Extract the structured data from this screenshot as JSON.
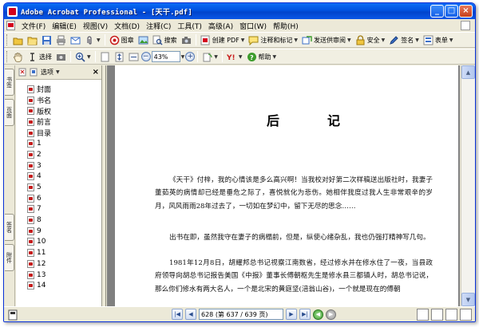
{
  "window": {
    "title": "Adobe Acrobat Professional - [天干.pdf]",
    "controls": {
      "minimize": "_",
      "maximize": "□",
      "close": "×"
    }
  },
  "menu": {
    "items": [
      "文件(F)",
      "编辑(E)",
      "视图(V)",
      "文档(D)",
      "注释(C)",
      "工具(T)",
      "高级(A)",
      "窗口(W)",
      "帮助(H)"
    ]
  },
  "toolbar1": {
    "buttons": [
      {
        "name": "open-icon",
        "color": "#e8b930"
      },
      {
        "name": "folder-icon",
        "color": "#e8b930"
      },
      {
        "name": "save-icon",
        "color": "#3a6fc8"
      },
      {
        "name": "print-icon",
        "color": "#7a7a7a"
      },
      {
        "name": "mail-icon",
        "color": "#3a6fc8"
      },
      {
        "name": "attach-icon",
        "color": "#6a8ab5"
      }
    ],
    "image_label": "图章",
    "search_label": "搜索",
    "create_pdf_label": "创建 PDF",
    "review_label": "注释和标记",
    "send_review_label": "发送供审阅",
    "secure_label": "安全",
    "sign_label": "签名",
    "forms_label": "表单"
  },
  "toolbar2": {
    "select_label": "选择",
    "zoom_value": "43%",
    "help_label": "帮助"
  },
  "left_tabs": [
    "书签",
    "页面",
    "签名",
    "附件"
  ],
  "bookmarks_panel": {
    "options_label": "选项",
    "close": "×",
    "items": [
      "封面",
      "书名",
      "版权",
      "前言",
      "目录",
      "1",
      "2",
      "3",
      "4",
      "5",
      "6",
      "7",
      "8",
      "9",
      "10",
      "11",
      "12",
      "13",
      "14"
    ]
  },
  "document": {
    "heading": "后　记",
    "paragraph1": "《天干》付梓，我的心情该是多么高兴啊！当我校对好第二次样稿送出版社时，我妻子董茹英的病情却已经是垂危之际了，喜悦就化为悲伤。她相伴我度过我人生非常艰辛的岁月，风风雨雨28年过去了，一切如在梦幻中，留下无尽的思念……",
    "paragraph2": "出书在即，虽然我守在妻子的病榻前，但是，纵使心绪杂乱，我也仍强打精神写几句。",
    "paragraph3": "1981年12月8日，胡耀邦总书记视察江南数省，经过修水并在修水住了一夜，当县政府领导向胡总书记报告美国《中报》董事长傅朝枢先生是修水县三都镇人时，胡总书记说，那么你们修水有两大名人，一个是北宋的黄庭坚(涪翁山谷)，一个就是现在的傅朝"
  },
  "statusbar": {
    "page_field": "628 (第 637 / 639 页)",
    "first": "|◀",
    "prev": "◀",
    "next": "▶",
    "last": "▶|"
  },
  "colors": {
    "titlebar": "#0052e0",
    "chrome": "#ece9d8",
    "doc_background": "#808080",
    "pdf_red": "#d4001c"
  }
}
